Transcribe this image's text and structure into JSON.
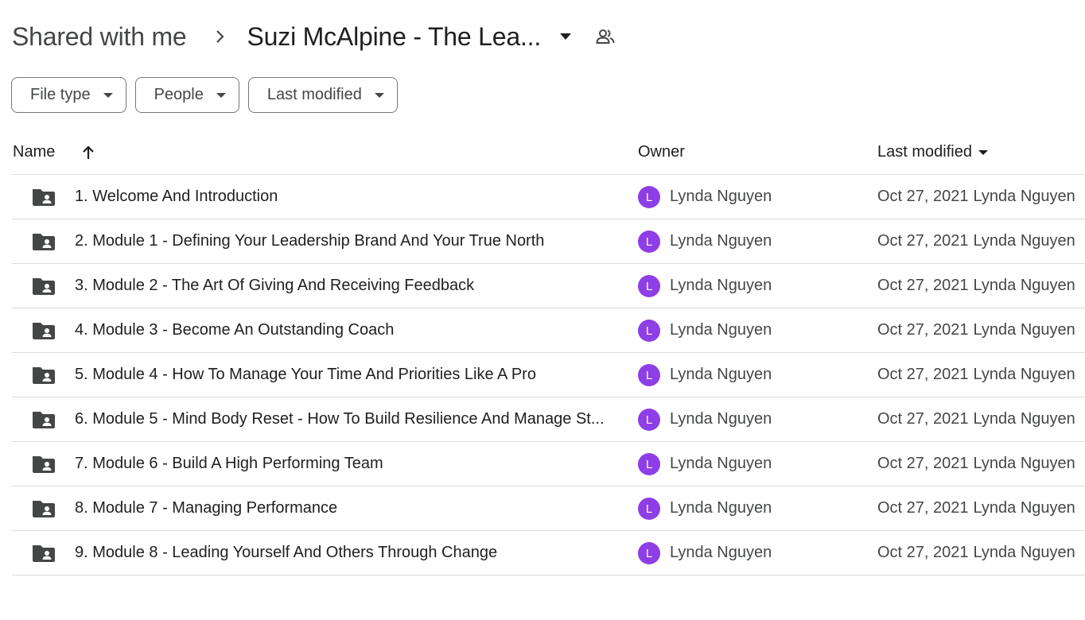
{
  "breadcrumb": {
    "root": "Shared with me",
    "current": "Suzi McAlpine - The Lea..."
  },
  "filters": [
    {
      "label": "File type"
    },
    {
      "label": "People"
    },
    {
      "label": "Last modified"
    }
  ],
  "columns": {
    "name": "Name",
    "owner": "Owner",
    "last_modified": "Last modified"
  },
  "accent": "#8e3ee6",
  "rows": [
    {
      "name": "1. Welcome And Introduction",
      "owner_initial": "L",
      "owner": "Lynda Nguyen",
      "date": "Oct 27, 2021",
      "modified_by": "Lynda Nguyen"
    },
    {
      "name": "2. Module 1 - Defining Your Leadership Brand And Your True North",
      "owner_initial": "L",
      "owner": "Lynda Nguyen",
      "date": "Oct 27, 2021",
      "modified_by": "Lynda Nguyen"
    },
    {
      "name": "3. Module 2 - The Art Of Giving And Receiving Feedback",
      "owner_initial": "L",
      "owner": "Lynda Nguyen",
      "date": "Oct 27, 2021",
      "modified_by": "Lynda Nguyen"
    },
    {
      "name": "4. Module 3 - Become An Outstanding Coach",
      "owner_initial": "L",
      "owner": "Lynda Nguyen",
      "date": "Oct 27, 2021",
      "modified_by": "Lynda Nguyen"
    },
    {
      "name": "5. Module 4 - How To Manage Your Time And Priorities Like A Pro",
      "owner_initial": "L",
      "owner": "Lynda Nguyen",
      "date": "Oct 27, 2021",
      "modified_by": "Lynda Nguyen"
    },
    {
      "name": "6. Module 5 - Mind Body Reset - How To Build Resilience And Manage St...",
      "owner_initial": "L",
      "owner": "Lynda Nguyen",
      "date": "Oct 27, 2021",
      "modified_by": "Lynda Nguyen"
    },
    {
      "name": "7. Module 6 - Build A High Performing Team",
      "owner_initial": "L",
      "owner": "Lynda Nguyen",
      "date": "Oct 27, 2021",
      "modified_by": "Lynda Nguyen"
    },
    {
      "name": "8. Module 7 - Managing Performance",
      "owner_initial": "L",
      "owner": "Lynda Nguyen",
      "date": "Oct 27, 2021",
      "modified_by": "Lynda Nguyen"
    },
    {
      "name": "9. Module 8 - Leading Yourself And Others Through Change",
      "owner_initial": "L",
      "owner": "Lynda Nguyen",
      "date": "Oct 27, 2021",
      "modified_by": "Lynda Nguyen"
    }
  ]
}
